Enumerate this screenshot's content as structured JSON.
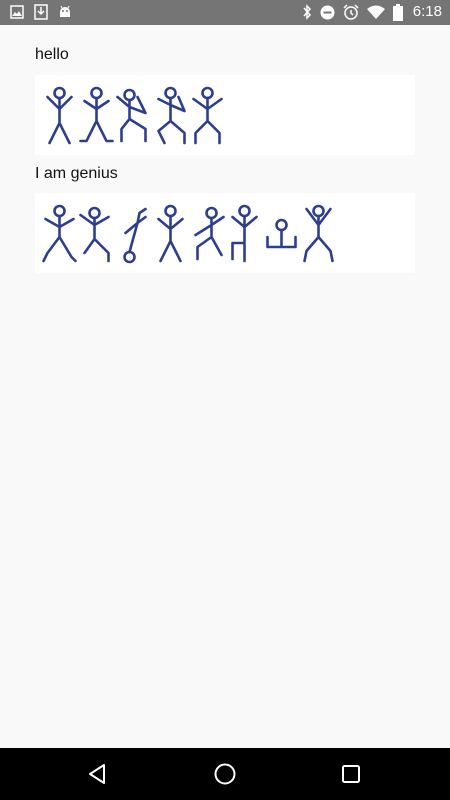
{
  "status_bar": {
    "time": "6:18",
    "left_icons": [
      "image-icon",
      "download-icon",
      "android-icon"
    ],
    "right_icons": [
      "bluetooth-icon",
      "do-not-disturb-icon",
      "alarm-icon",
      "wifi-icon",
      "battery-icon"
    ]
  },
  "messages": [
    {
      "label": "hello",
      "figure_count": 5
    },
    {
      "label": "I am genius",
      "figure_count": 8
    }
  ],
  "nav_bar": {
    "icons": [
      "back-icon",
      "home-icon",
      "recents-icon"
    ]
  },
  "colors": {
    "figure_stroke": "#2e3e8f",
    "status_bar_bg": "#757575",
    "nav_bar_bg": "#000000",
    "page_bg": "#f9f9f9"
  }
}
